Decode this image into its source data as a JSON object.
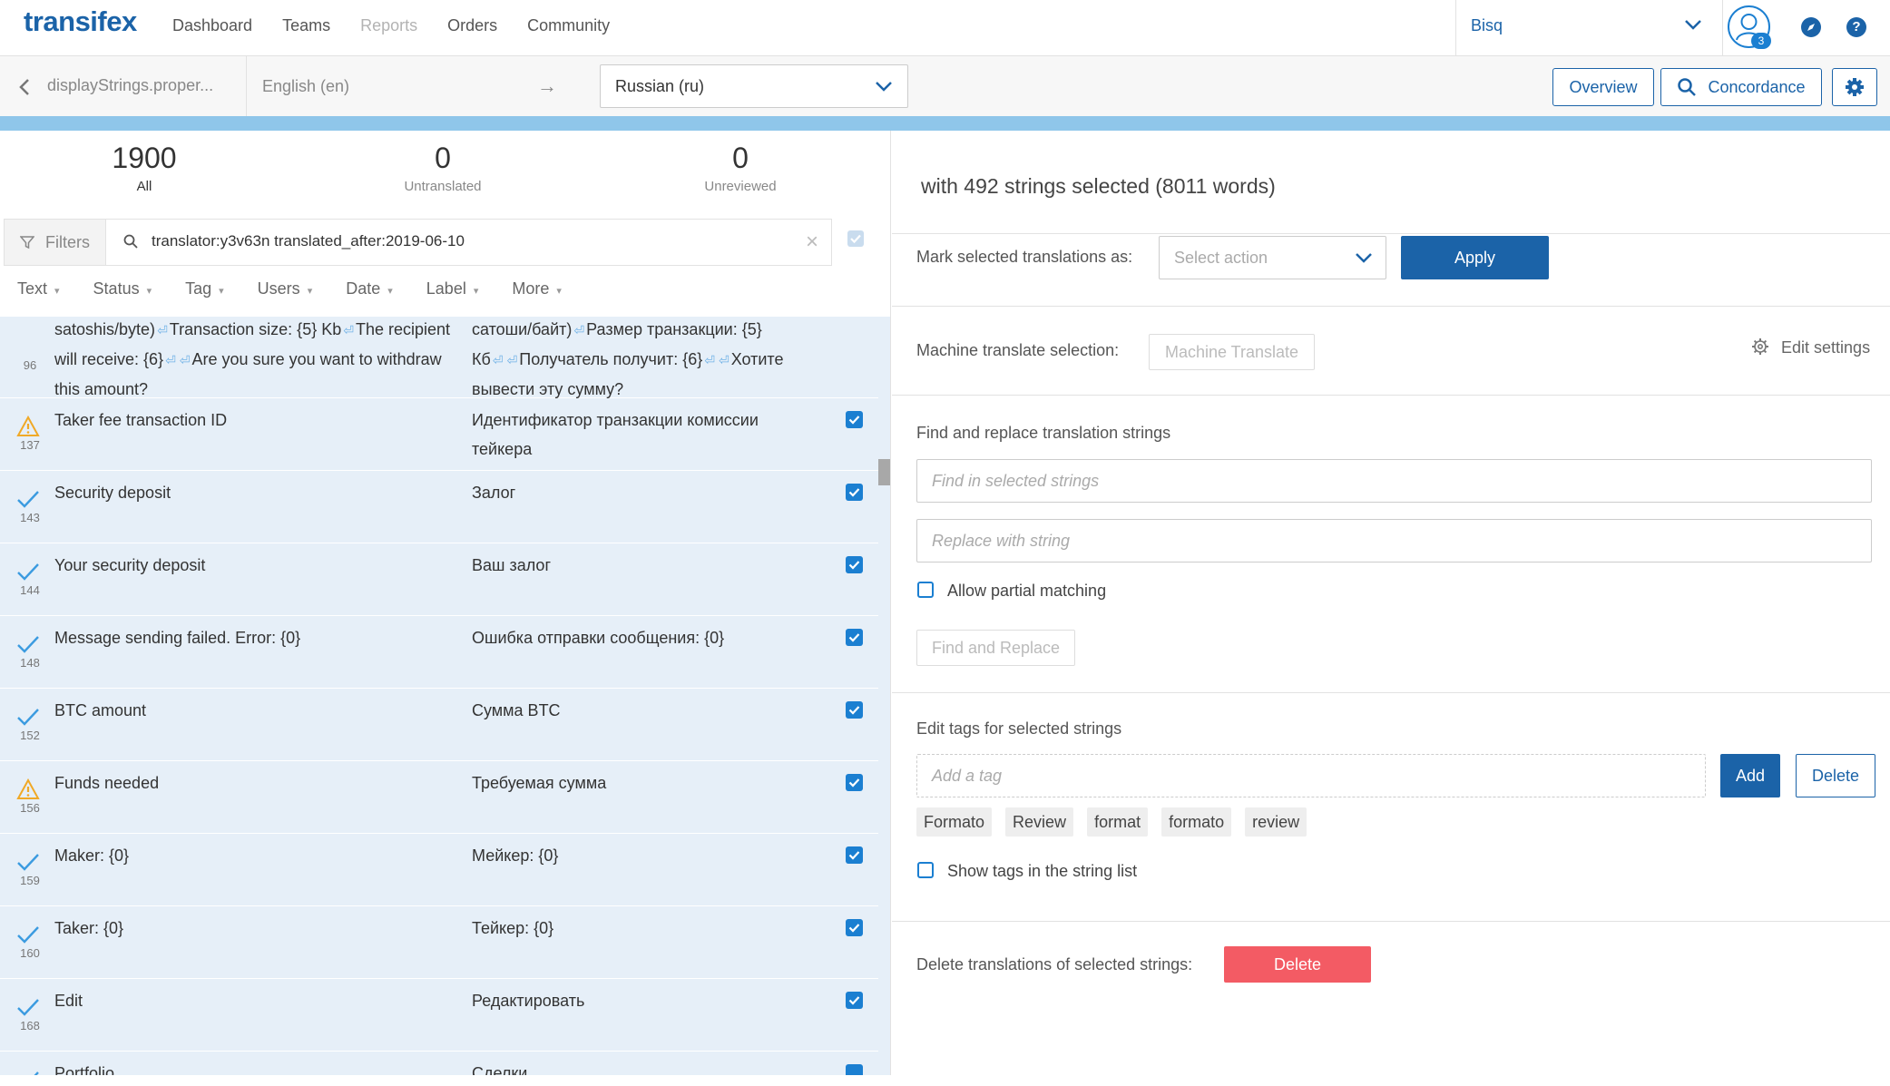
{
  "nav": {
    "logo": "transifex",
    "links": [
      "Dashboard",
      "Teams",
      "Reports",
      "Orders",
      "Community"
    ],
    "org": "Bisq",
    "notification_count": "3",
    "compass_icon": "compass-icon",
    "help_icon": "help-icon"
  },
  "langbar": {
    "file": "displayStrings.proper...",
    "source_lang": "English (en)",
    "arrow": "→",
    "target_lang": "Russian (ru)",
    "overview": "Overview",
    "concordance": "Concordance"
  },
  "stats": [
    {
      "value": "1900",
      "label": "All"
    },
    {
      "value": "0",
      "label": "Untranslated"
    },
    {
      "value": "0",
      "label": "Unreviewed"
    }
  ],
  "filters": {
    "button": "Filters",
    "query": "translator:y3v63n translated_after:2019-06-10",
    "columns": [
      "Text",
      "Status",
      "Tag",
      "Users",
      "Date",
      "Label",
      "More"
    ]
  },
  "rows": [
    {
      "num": "96",
      "status": "none",
      "src": [
        "satoshis/byte)",
        "Transaction size: {5} Kb",
        "The recipient will receive: {6}",
        "",
        "Are you sure you want to withdraw this amount?"
      ],
      "tgt": [
        "сатоши/байт)",
        "Размер транзакции: {5} Кб",
        "",
        "Получатель получит: {6}",
        "",
        "Хотите вывести эту сумму?"
      ],
      "checked": false
    },
    {
      "num": "137",
      "status": "warning",
      "src_text": "Taker fee transaction ID",
      "tgt_text": "Идентификатор транзакции комиссии тейкера",
      "checked": true
    },
    {
      "num": "143",
      "status": "check",
      "src_text": "Security deposit",
      "tgt_text": "Залог",
      "checked": true
    },
    {
      "num": "144",
      "status": "check",
      "src_text": "Your security deposit",
      "tgt_text": "Ваш залог",
      "checked": true
    },
    {
      "num": "148",
      "status": "check",
      "src_text": "Message sending failed. Error: {0}",
      "tgt_text": "Ошибка отправки сообщения: {0}",
      "checked": true
    },
    {
      "num": "152",
      "status": "check",
      "src_text": "BTC amount",
      "tgt_text": "Сумма BTC",
      "checked": true
    },
    {
      "num": "156",
      "status": "warning",
      "src_text": "Funds needed",
      "tgt_text": "Требуемая сумма",
      "checked": true
    },
    {
      "num": "159",
      "status": "check",
      "src_text": "Maker: {0}",
      "tgt_text": "Мейкер: {0}",
      "checked": true
    },
    {
      "num": "160",
      "status": "check",
      "src_text": "Taker: {0}",
      "tgt_text": "Тейкер: {0}",
      "checked": true
    },
    {
      "num": "168",
      "status": "check",
      "src_text": "Edit",
      "tgt_text": "Редактировать",
      "checked": true
    },
    {
      "num": "",
      "status": "check",
      "src_text": "Portfolio",
      "tgt_text": "Сделки",
      "checked": true
    }
  ],
  "bulk": {
    "title": "with 492 strings selected (8011 words)",
    "mark_label": "Mark selected translations as:",
    "select_placeholder": "Select action",
    "apply": "Apply",
    "mt_label": "Machine translate selection:",
    "mt_button": "Machine Translate",
    "edit_settings": "Edit settings",
    "find_replace_title": "Find and replace translation strings",
    "find_placeholder": "Find in selected strings",
    "replace_placeholder": "Replace with string",
    "partial": "Allow partial matching",
    "find_replace_btn": "Find and Replace",
    "tags_title": "Edit tags for selected strings",
    "tag_placeholder": "Add a tag",
    "add": "Add",
    "delete_tag": "Delete",
    "tags": [
      "Formato",
      "Review",
      "format",
      "formato",
      "review"
    ],
    "show_tags": "Show tags in the string list",
    "delete_label": "Delete translations of selected strings:",
    "delete_btn": "Delete"
  },
  "colors": {
    "brand": "#1b63a8",
    "progress": "#8fc6ea",
    "list_bg": "#e6eff8",
    "danger": "#f35b64",
    "warning": "#f0a927",
    "check": "#3b9be0"
  }
}
